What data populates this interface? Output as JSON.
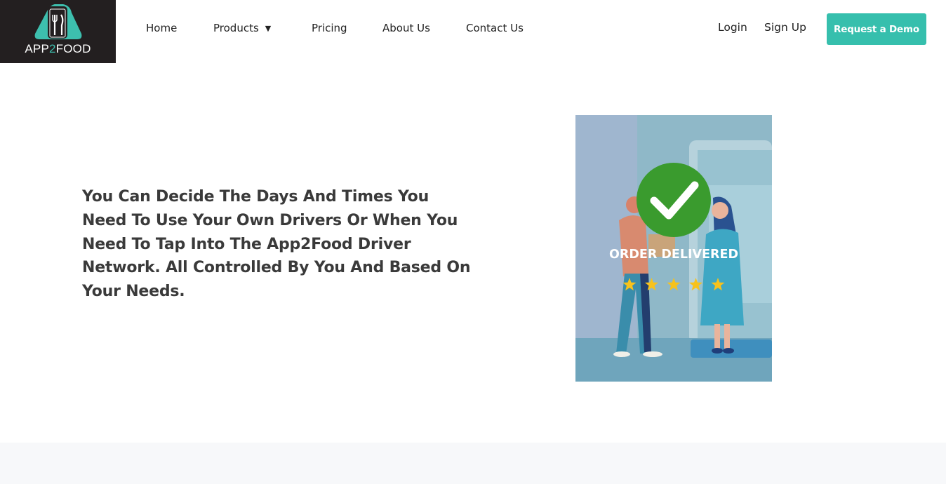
{
  "brand": {
    "name_prefix": "APP",
    "name_accent": "2",
    "name_suffix": "FOOD",
    "accent_color": "#3dbfae",
    "logo_bg": "#231f20",
    "logo_icon": "phone-fork-knife-icon"
  },
  "nav": {
    "items": [
      {
        "label": "Home"
      },
      {
        "label": "Products",
        "has_dropdown": true
      },
      {
        "label": "Pricing"
      },
      {
        "label": "About Us"
      },
      {
        "label": "Contact Us"
      }
    ],
    "dropdown_icon": "chevron-down-icon"
  },
  "auth": {
    "login_label": "Login",
    "signup_label": "Sign Up"
  },
  "cta": {
    "label": "Request a Demo",
    "color": "#36bfad"
  },
  "main": {
    "headline": "You Can Decide The Days And Times You Need To Use Your Own Drivers Or When You Need To Tap Into The App2Food Driver Network. All Controlled By You And Based On Your Needs.",
    "illustration": {
      "caption": "ORDER DELIVERED",
      "rating_stars": 5,
      "icon": "checkmark-circle-icon",
      "check_color": "#3a9b2e",
      "star_color": "#f7c21c"
    }
  }
}
